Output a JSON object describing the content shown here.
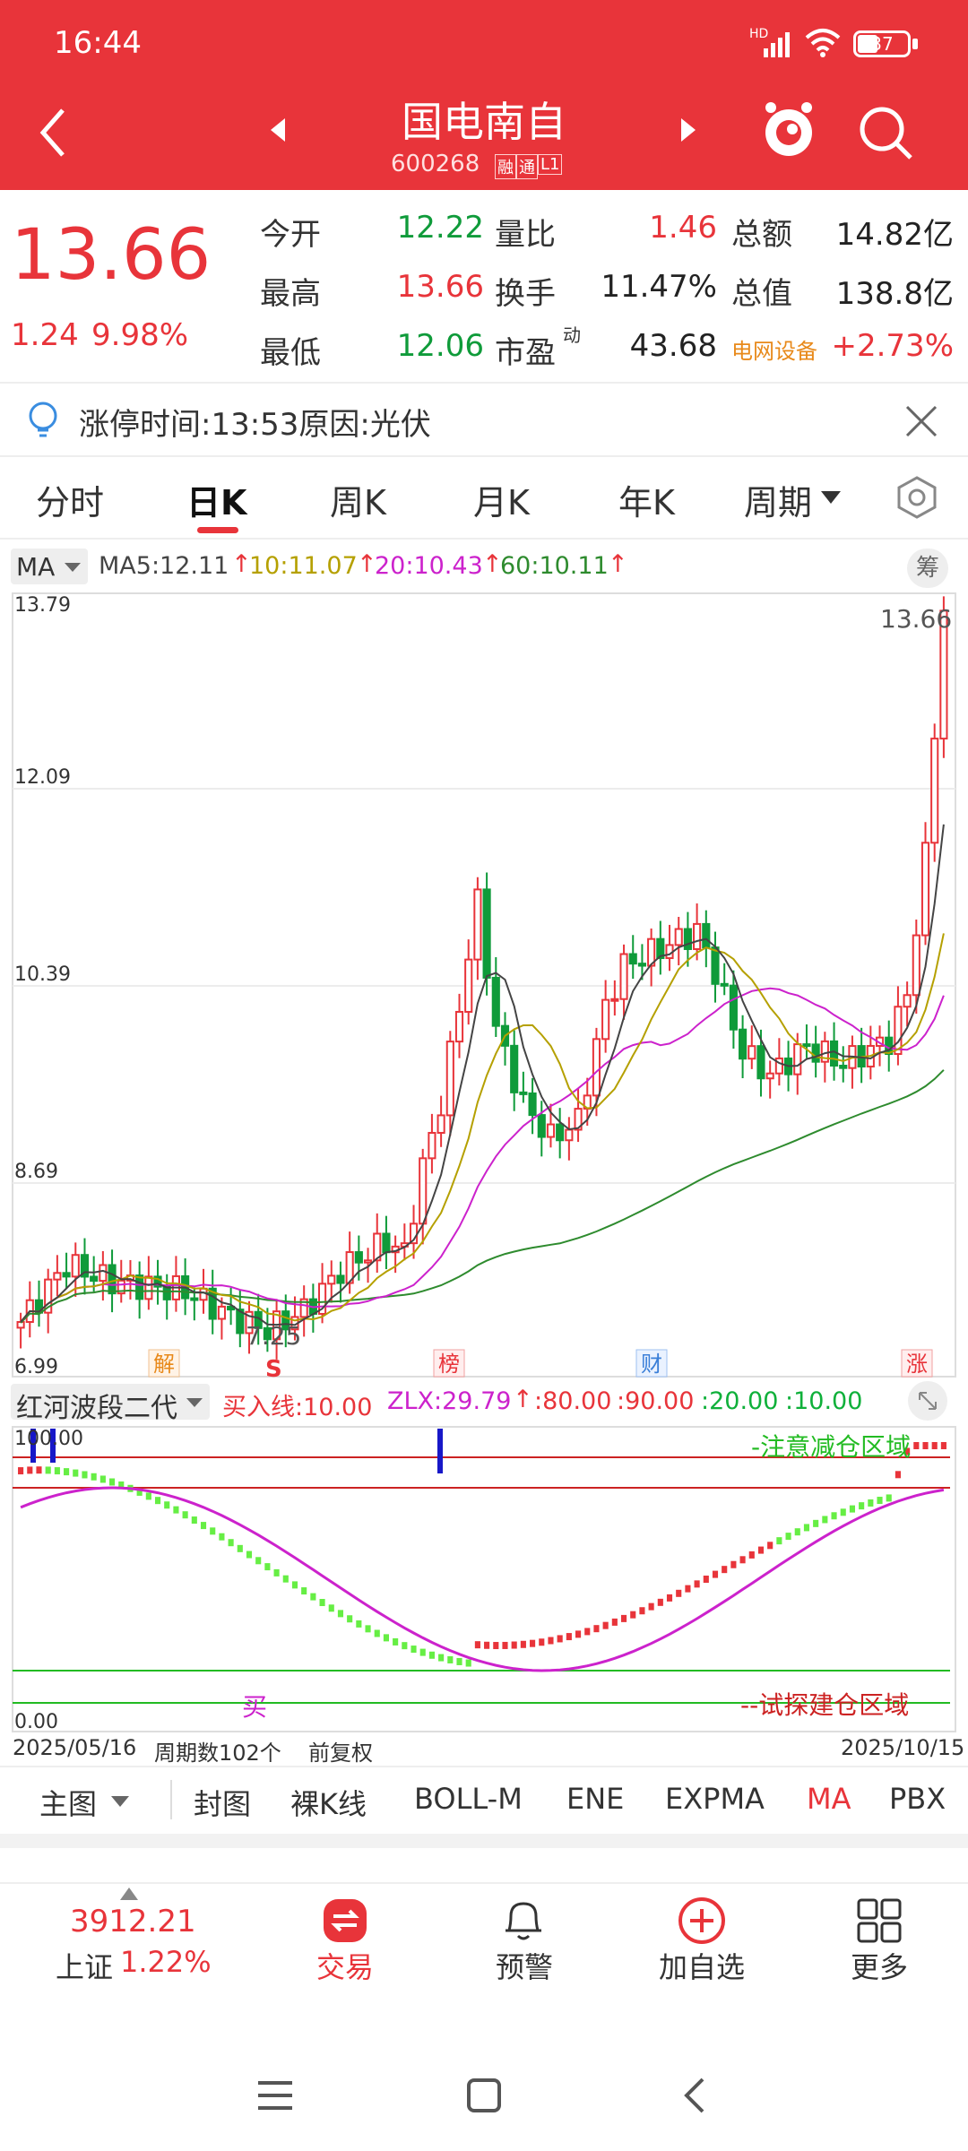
{
  "status_bar": {
    "time": "16:44",
    "network": "HD",
    "battery": "37"
  },
  "header": {
    "title": "国电南自",
    "code": "600268",
    "badge1": "融",
    "badge2": "通",
    "badge3": "L1"
  },
  "quote": {
    "price": "13.66",
    "change": "1.24",
    "change_pct": "9.98%",
    "rows": [
      {
        "l1": "今开",
        "v1": "12.22",
        "l2": "量比",
        "v2": "1.46",
        "l3": "总额",
        "v3": "14.82亿"
      },
      {
        "l1": "最高",
        "v1": "13.66",
        "l2": "换手",
        "v2": "11.47%",
        "l3": "总值",
        "v3": "138.8亿"
      },
      {
        "l1": "最低",
        "v1": "12.06",
        "l2": "市盈",
        "l2sup": "动",
        "v2": "43.68",
        "l3": "电网设备",
        "v3": "+2.73%"
      }
    ]
  },
  "notice": {
    "text": "涨停时间:13:53原因:光伏"
  },
  "tabs": [
    "分时",
    "日K",
    "周K",
    "月K",
    "年K",
    "周期"
  ],
  "ma_bar": {
    "select": "MA",
    "ma5": "MA5:12.11",
    "ma10": "10:11.07",
    "ma20": "20:10.43",
    "ma60": "60:10.11",
    "chip": "筹"
  },
  "main_chart": {
    "y_labels": [
      "13.79",
      "12.09",
      "10.39",
      "8.69",
      "6.99"
    ],
    "high_label": "13.66",
    "low_label": "7.25",
    "events": [
      "解",
      "S",
      "榜",
      "财",
      "涨"
    ]
  },
  "indicator": {
    "select": "红河波段二代",
    "buy_line": "买入线:10.00",
    "zlx": "ZLX:29.79",
    "p80": ":80.00",
    "p90": ":90.00",
    "p20": ":20.00",
    "p10": ":10.00",
    "top_label": "100.00",
    "bottom_label": "0.00",
    "zone_top": "-注意减仓区域",
    "zone_bottom": "--试探建仓区域",
    "buy_mark": "买"
  },
  "axis": {
    "start": "2025/05/16",
    "periods": "周期数102个",
    "adjust": "前复权",
    "end": "2025/10/15"
  },
  "func_tabs": [
    "主图",
    "封图",
    "裸K线",
    "BOLL-M",
    "ENE",
    "EXPMA",
    "MA",
    "PBX"
  ],
  "bottom_nav": {
    "index_value": "3912.21",
    "index_name": "上证",
    "index_pct": "1.22%",
    "trade": "交易",
    "alert": "预警",
    "add": "加自选",
    "more": "更多"
  },
  "colors": {
    "brand": "#e8343a",
    "up": "#e8343a",
    "down": "#0f9b3a",
    "ma5": "#444444",
    "ma10": "#b5a000",
    "ma20": "#cc22cc",
    "ma60": "#2e8b2e"
  }
}
